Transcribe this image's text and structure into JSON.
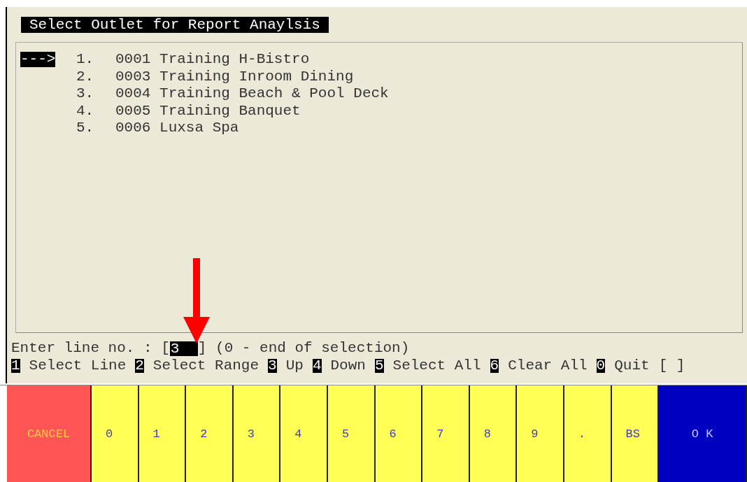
{
  "title": "Select Outlet for Report Anaylsis",
  "pointer": "--->",
  "outlets": [
    {
      "number": "1.",
      "code": "0001",
      "name": "Training H-Bistro",
      "selected": true
    },
    {
      "number": "2.",
      "code": "0003",
      "name": "Training Inroom Dining",
      "selected": false
    },
    {
      "number": "3.",
      "code": "0004",
      "name": "Training Beach & Pool Deck",
      "selected": false
    },
    {
      "number": "4.",
      "code": "0005",
      "name": "Training Banquet",
      "selected": false
    },
    {
      "number": "5.",
      "code": "0006",
      "name": "Luxsa Spa",
      "selected": false
    }
  ],
  "prompt": {
    "label": "Enter line no. : [",
    "value": "3",
    "after": "] (0 - end of selection)"
  },
  "hotkeys": [
    {
      "key": "1",
      "label": "Select Line"
    },
    {
      "key": "2",
      "label": "Select Range"
    },
    {
      "key": "3",
      "label": "Up"
    },
    {
      "key": "4",
      "label": "Down"
    },
    {
      "key": "5",
      "label": "Select All"
    },
    {
      "key": "6",
      "label": "Clear All"
    },
    {
      "key": "0",
      "label": "Quit"
    }
  ],
  "choice": "[ ]",
  "keypad": [
    {
      "label": "CANCEL",
      "kind": "cancel"
    },
    {
      "label": "0",
      "kind": "digit"
    },
    {
      "label": "1",
      "kind": "digit"
    },
    {
      "label": "2",
      "kind": "digit"
    },
    {
      "label": "3",
      "kind": "digit"
    },
    {
      "label": "4",
      "kind": "digit"
    },
    {
      "label": "5",
      "kind": "digit"
    },
    {
      "label": "6",
      "kind": "digit"
    },
    {
      "label": "7",
      "kind": "digit"
    },
    {
      "label": "8",
      "kind": "digit"
    },
    {
      "label": "9",
      "kind": "digit"
    },
    {
      "label": ".",
      "kind": "digit"
    },
    {
      "label": "BS",
      "kind": "digit"
    },
    {
      "label": "O K",
      "kind": "ok"
    }
  ]
}
